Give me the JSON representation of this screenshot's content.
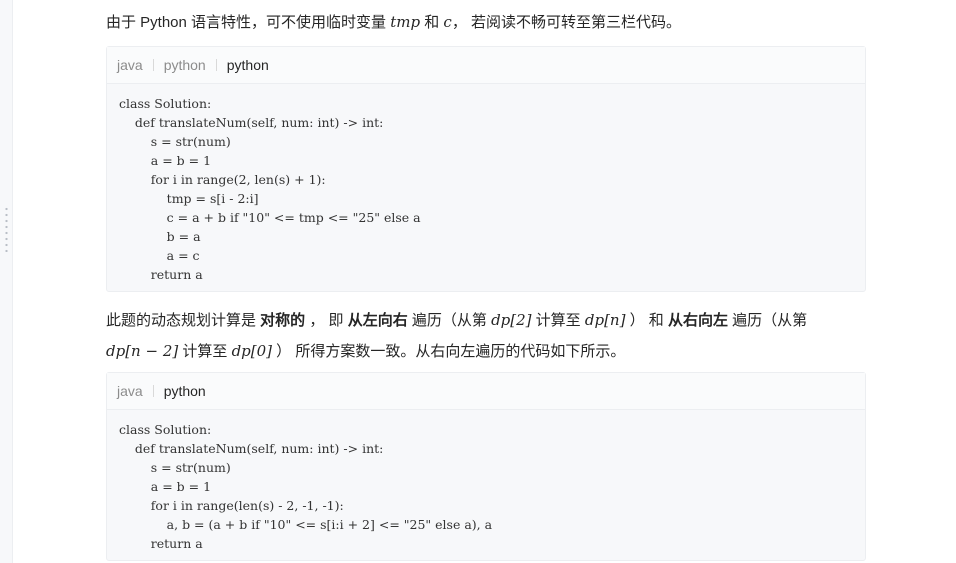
{
  "intro": {
    "text_before": "由于 Python 语言特性，可不使用临时变量 ",
    "var1": "tmp",
    "text_mid": " 和 ",
    "var2": "c",
    "text_after": "， 若阅读不畅可转至第三栏代码。"
  },
  "block1": {
    "tabs": [
      {
        "label": "java",
        "active": false
      },
      {
        "label": "python",
        "active": false
      },
      {
        "label": "python",
        "active": true
      }
    ],
    "code": [
      "class Solution:",
      "    def translateNum(self, num: int) -> int:",
      "        s = str(num)",
      "        a = b = 1",
      "        for i in range(2, len(s) + 1):",
      "            tmp = s[i - 2:i]",
      "            c = a + b if \"10\" <= tmp <= \"25\" else a",
      "            b = a",
      "            a = c",
      "        return a"
    ]
  },
  "paragraph2": {
    "p1": "此题的动态规划计算是 ",
    "b1": "对称的",
    "p2": " ， 即 ",
    "b2": "从左向右",
    "p3": " 遍历（从第 ",
    "m1": "dp[2]",
    "p4": " 计算至 ",
    "m2": "dp[n]",
    "p5": " ） 和 ",
    "b3": "从右向左",
    "p6": " 遍历（从第",
    "m3": "dp[n − 2]",
    "p7": " 计算至 ",
    "m4": "dp[0]",
    "p8": " ） 所得方案数一致。从右向左遍历的代码如下所示。"
  },
  "block2": {
    "tabs": [
      {
        "label": "java",
        "active": false
      },
      {
        "label": "python",
        "active": true
      }
    ],
    "code": [
      "class Solution:",
      "    def translateNum(self, num: int) -> int:",
      "        s = str(num)",
      "        a = b = 1",
      "        for i in range(len(s) - 2, -1, -1):",
      "            a, b = (a + b if \"10\" <= s[i:i + 2] <= \"25\" else a), a",
      "        return a"
    ]
  }
}
